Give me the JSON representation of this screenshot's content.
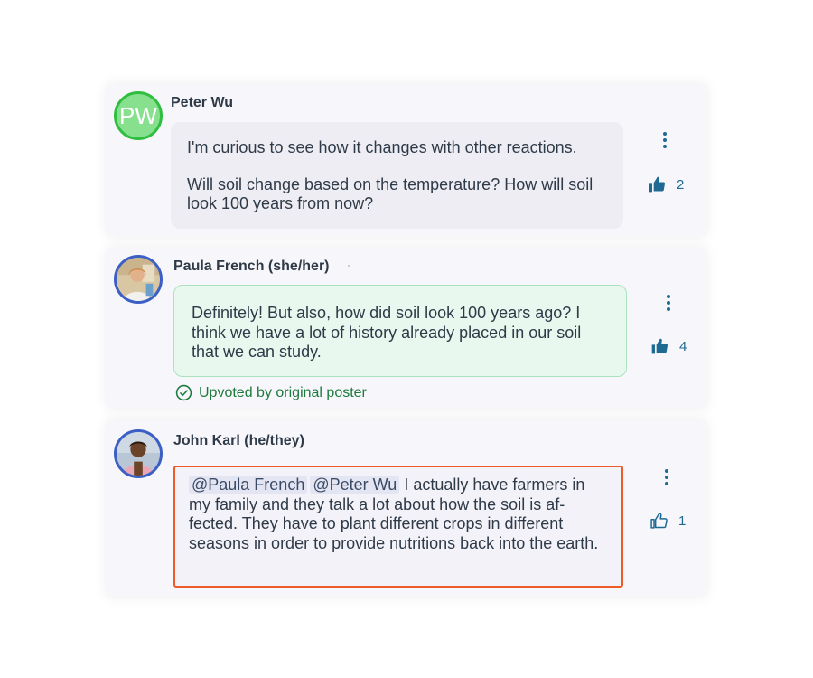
{
  "comments": [
    {
      "author": "Peter Wu",
      "avatar_initials": "PW",
      "paragraphs": [
        "I'm curious to see how it changes with other reactions.",
        "Will soil change based on the temperature? How will soil look 100 years from now?"
      ],
      "likes": "2",
      "liked": true
    },
    {
      "author": "Paula French (she/her)",
      "text": "Definitely! But also, how did soil look 100 years ago? I think we have a lot of history already placed in our soil that we can study.",
      "likes": "4",
      "liked": true,
      "badge": "Upvoted by original poster"
    },
    {
      "author": "John Karl (he/they)",
      "mentions": [
        "@Paula French",
        "@Peter Wu"
      ],
      "text": "I actually have farmers in my family and they talk a lot about how the soil is af-fected. They have to plant different crops in different seasons in order to provide nutritions back into the earth.",
      "likes": "1",
      "liked": false
    }
  ],
  "icons": {
    "menu": "kebab-icon",
    "like_filled": "thumbs-up-filled-icon",
    "like_outline": "thumbs-up-outline-icon",
    "upvoted": "check-circle-icon"
  },
  "colors": {
    "accent": "#1f6a93",
    "success": "#1d7a3d",
    "highlight_border": "#ee5b29",
    "pw_avatar_bg": "#86e08e",
    "pw_avatar_border": "#2fbe3f"
  }
}
